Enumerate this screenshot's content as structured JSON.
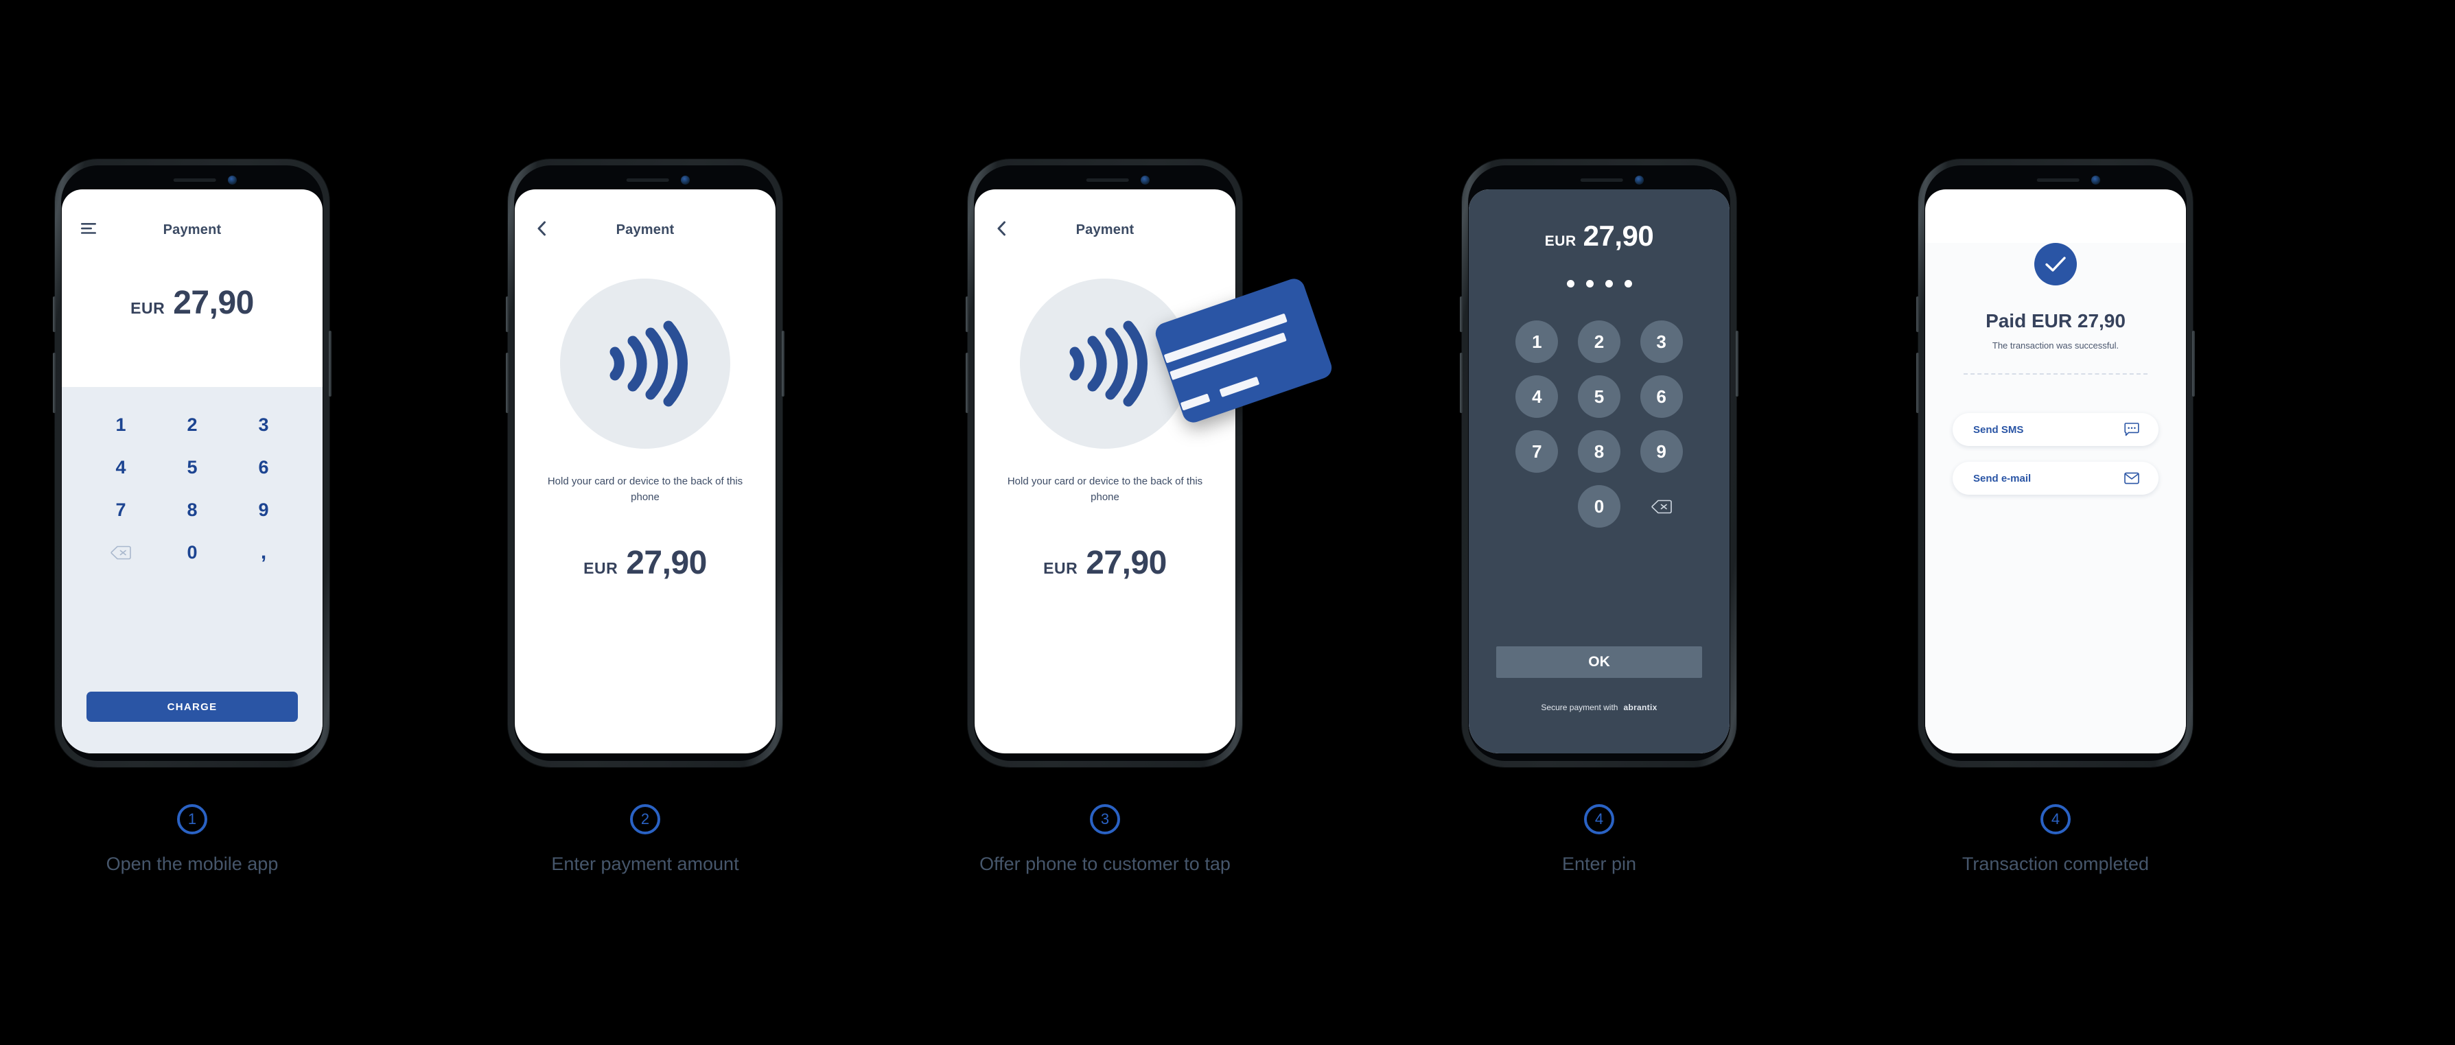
{
  "steps": [
    {
      "number": "1",
      "label": "Open the mobile app",
      "screen": {
        "header_title": "Payment",
        "header_icon": "hamburger-menu-icon",
        "currency": "EUR",
        "amount": "27,90",
        "keys": [
          "1",
          "2",
          "3",
          "4",
          "5",
          "6",
          "7",
          "8",
          "9",
          "backspace",
          "0",
          ","
        ],
        "charge_label": "CHARGE"
      }
    },
    {
      "number": "2",
      "label": "Enter payment amount",
      "screen": {
        "header_title": "Payment",
        "header_icon": "back-chevron-icon",
        "nfc_icon": "contactless-nfc-icon",
        "hint": "Hold your card or device to the back of this phone",
        "currency": "EUR",
        "amount": "27,90"
      }
    },
    {
      "number": "3",
      "label": "Offer phone to customer to tap",
      "screen": {
        "header_title": "Payment",
        "header_icon": "back-chevron-icon",
        "nfc_icon": "contactless-nfc-icon",
        "hint": "Hold your card or device to the back of this phone",
        "currency": "EUR",
        "amount": "27,90",
        "card_graphic": "credit-card-icon"
      }
    },
    {
      "number": "4",
      "label": "Enter pin",
      "screen": {
        "currency": "EUR",
        "amount": "27,90",
        "pin_dots_filled": 4,
        "keys": [
          "1",
          "2",
          "3",
          "4",
          "5",
          "6",
          "7",
          "8",
          "9",
          "",
          "0",
          "backspace"
        ],
        "ok_label": "OK",
        "footer_text": "Secure payment with",
        "footer_brand": "abrantix"
      }
    },
    {
      "number": "4",
      "label": "Transaction completed",
      "screen": {
        "check_icon": "checkmark-icon",
        "title": "Paid EUR 27,90",
        "subtitle": "The transaction was successful.",
        "actions": [
          {
            "label": "Send SMS",
            "icon": "speech-bubble-icon"
          },
          {
            "label": "Send e-mail",
            "icon": "envelope-icon"
          }
        ]
      }
    }
  ],
  "colors": {
    "background": "#000000",
    "brand_blue": "#2a55a5",
    "accent_blue": "#2a62c4",
    "navy_text": "#36425c",
    "keypad_bg": "#e8edf3",
    "pin_bg": "#3a4756",
    "pin_key": "#5d6d7d",
    "caption_text": "#46566b"
  }
}
